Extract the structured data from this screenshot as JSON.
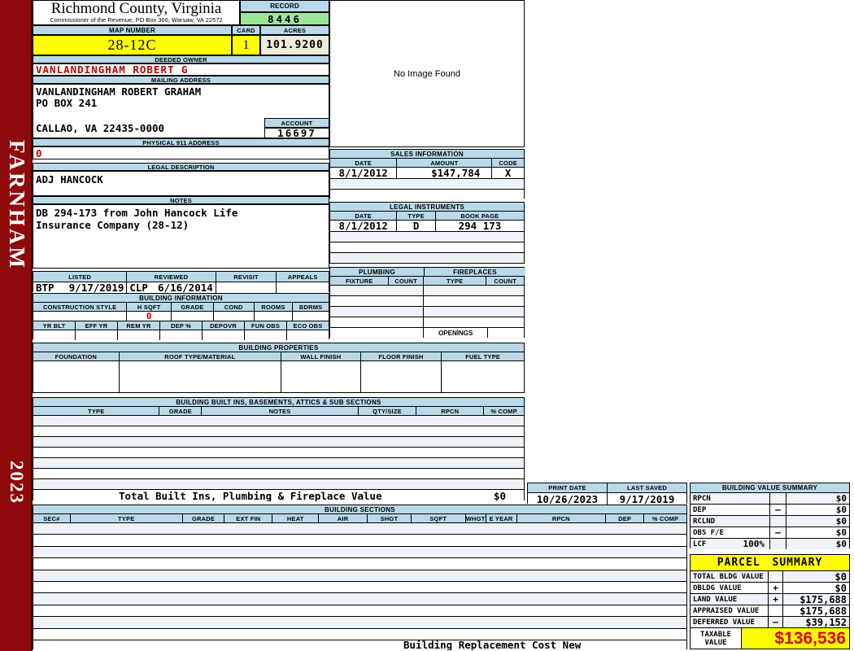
{
  "colors": {
    "blue": "#b9d9e9",
    "yellow": "#ffff00",
    "green": "#99e699",
    "cream": "#eceada",
    "red": "#c00000",
    "redbright": "#dd0000",
    "sidebar": "#8e0909",
    "rowalt": "#eef3fa"
  },
  "sidebar": {
    "district": "FARNHAM",
    "year": "2023"
  },
  "header": {
    "county": "Richmond County, Virginia",
    "office_line": "Commissioner of the Revenue,  PO Box 366,  Warsaw, VA 22572"
  },
  "record": {
    "label": "RECORD",
    "value": "8446"
  },
  "map_number": {
    "label": "MAP NUMBER",
    "value": "28-12C"
  },
  "card": {
    "label": "CARD",
    "value": "1"
  },
  "acres": {
    "label": "ACRES",
    "value": "101.9200"
  },
  "deeded_owner": {
    "label": "DEEDED OWNER",
    "value": "VANLANDINGHAM ROBERT G"
  },
  "mailing_address": {
    "label": "MAILING ADDRESS",
    "line1": "VANLANDINGHAM ROBERT GRAHAM",
    "line2": "PO BOX 241",
    "line3": "CALLAO, VA 22435-0000"
  },
  "account": {
    "label": "ACCOUNT",
    "value": "16697"
  },
  "physical_address": {
    "label": "PHYSICAL 911 ADDRESS",
    "value": "0"
  },
  "legal_description": {
    "label": "LEGAL DESCRIPTION",
    "value": "ADJ HANCOCK"
  },
  "notes": {
    "label": "NOTES",
    "line1": "DB 294-173 from John Hancock Life",
    "line2": "Insurance Company (28-12)"
  },
  "image_panel": {
    "message": "No Image Found"
  },
  "sales_information": {
    "title": "SALES INFORMATION",
    "headers": [
      "DATE",
      "AMOUNT",
      "CODE"
    ],
    "row": {
      "date": "8/1/2012",
      "amount": "$147,784",
      "code": "X"
    }
  },
  "legal_instruments": {
    "title": "LEGAL INSTRUMENTS",
    "headers": [
      "DATE",
      "TYPE",
      "BOOK PAGE"
    ],
    "row": {
      "date": "8/1/2012",
      "type": "D",
      "book_page": "294 173"
    }
  },
  "plumbing": {
    "title": "PLUMBING",
    "headers": [
      "FIXTURE",
      "COUNT"
    ]
  },
  "fireplaces": {
    "title": "FIREPLACES",
    "headers": [
      "TYPE",
      "COUNT"
    ],
    "openings_label": "OPENINGS"
  },
  "review": {
    "listed_label": "LISTED",
    "listed_by": "BTP",
    "listed_date": "9/17/2019",
    "reviewed_label": "REVIEWED",
    "reviewed_by": "CLP",
    "reviewed_date": "6/16/2014",
    "revisit_label": "REVISIT",
    "appeals_label": "APPEALS"
  },
  "building_information": {
    "title": "BUILDING INFORMATION",
    "row1_headers": [
      "CONSTRUCTION STYLE",
      "H SQFT",
      "GRADE",
      "COND",
      "ROOMS",
      "BDRMS"
    ],
    "h_sqft_value": "0",
    "row2_headers": [
      "YR BLT",
      "EFF YR",
      "REM YR",
      "DEP %",
      "DEPOVR",
      "FUN OBS",
      "ECO OBS"
    ]
  },
  "building_properties": {
    "title": "BUILDING PROPERTIES",
    "headers": [
      "FOUNDATION",
      "ROOF TYPE/MATERIAL",
      "WALL FINISH",
      "FLOOR FINISH",
      "FUEL TYPE"
    ]
  },
  "built_ins": {
    "title": "BUILDING BUILT INS, BASEMENTS, ATTICS & SUB SECTIONS",
    "headers": [
      "TYPE",
      "GRADE",
      "NOTES",
      "QTY/SIZE",
      "RPCN",
      "% COMP"
    ],
    "total_label": "Total Built Ins, Plumbing & Fireplace Value",
    "total_value": "$0"
  },
  "print_date": {
    "label": "PRINT DATE",
    "value": "10/26/2023"
  },
  "last_saved": {
    "label": "LAST SAVED",
    "value": "9/17/2019"
  },
  "building_value_summary": {
    "title": "BUILDING VALUE SUMMARY",
    "rows": [
      {
        "label": "RPCN",
        "op": "",
        "value": "$0"
      },
      {
        "label": "DEP",
        "op": "–",
        "value": "$0"
      },
      {
        "label": "RCLND",
        "op": "",
        "value": "$0"
      },
      {
        "label": "OBS F/E",
        "op": "–",
        "value": "$0"
      },
      {
        "label": "LCF",
        "pct": "100%",
        "op": "",
        "value": "$0"
      }
    ]
  },
  "building_sections": {
    "title": "BUILDING SECTIONS",
    "headers": [
      "SEC#",
      "TYPE",
      "GRADE",
      "EXT FIN",
      "HEAT",
      "AIR",
      "SHGT",
      "SQFT",
      "WHGT",
      "E YEAR",
      "RPCN",
      "DEP",
      "% COMP"
    ],
    "footer_note": "Building Replacement Cost New"
  },
  "parcel_summary": {
    "title": "PARCEL SUMMARY",
    "rows": [
      {
        "label": "TOTAL BLDG VALUE",
        "op": "",
        "value": "$0"
      },
      {
        "label": "OBLDG VALUE",
        "op": "+",
        "value": "$0"
      },
      {
        "label": "LAND VALUE",
        "op": "+",
        "value": "$175,688"
      },
      {
        "label": "APPRAISED VALUE",
        "op": "",
        "value": "$175,688"
      },
      {
        "label": "DEFERRED VALUE",
        "op": "–",
        "value": "$39,152"
      }
    ],
    "taxable_label_line1": "TAXABLE",
    "taxable_label_line2": "VALUE",
    "taxable_value": "$136,536"
  }
}
